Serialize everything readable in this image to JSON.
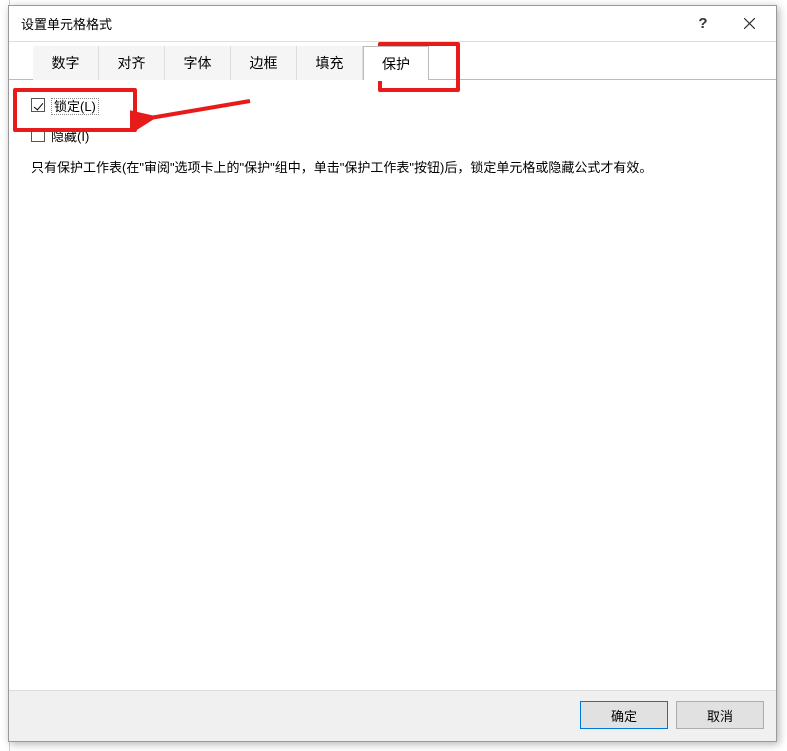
{
  "dialog": {
    "title": "设置单元格格式",
    "help_label": "?",
    "tabs": [
      {
        "label": "数字"
      },
      {
        "label": "对齐"
      },
      {
        "label": "字体"
      },
      {
        "label": "边框"
      },
      {
        "label": "填充"
      },
      {
        "label": "保护"
      }
    ],
    "active_tab": "保护",
    "protection": {
      "locked_label": "锁定(L)",
      "locked_checked": true,
      "hidden_label": "隐藏(I)",
      "hidden_checked": false,
      "description": "只有保护工作表(在\"审阅\"选项卡上的\"保护\"组中，单击\"保护工作表\"按钮)后，锁定单元格或隐藏公式才有效。"
    },
    "buttons": {
      "ok": "确定",
      "cancel": "取消"
    }
  }
}
